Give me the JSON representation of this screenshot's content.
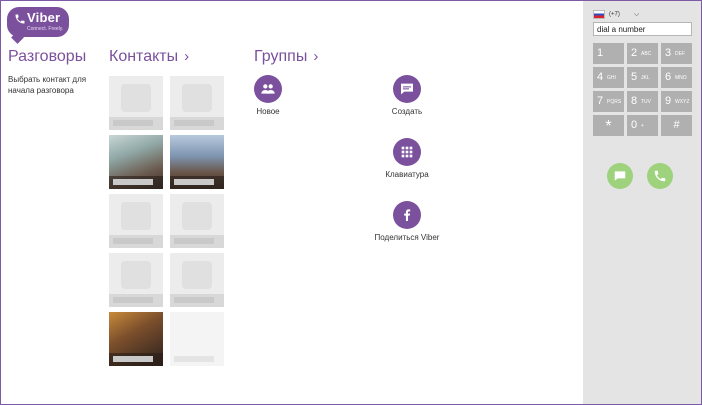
{
  "logo": {
    "word": "Viber",
    "tagline": "Connect. Freely."
  },
  "sections": {
    "conversations": {
      "title": "Разговоры"
    },
    "contacts": {
      "title": "Контакты",
      "chevron": "›"
    },
    "groups": {
      "title": "Группы",
      "chevron": "›"
    }
  },
  "conversations_hint": "Выбрать контакт для начала разговора",
  "contacts_grid": [
    {
      "kind": "placeholder"
    },
    {
      "kind": "placeholder"
    },
    {
      "kind": "photo1"
    },
    {
      "kind": "photo2"
    },
    {
      "kind": "placeholder"
    },
    {
      "kind": "placeholder"
    },
    {
      "kind": "placeholder"
    },
    {
      "kind": "placeholder"
    },
    {
      "kind": "photo3"
    },
    {
      "kind": "empty"
    }
  ],
  "actions": {
    "new_group": {
      "label": "Новое",
      "icon": "group-icon"
    },
    "create": {
      "label": "Создать",
      "icon": "chat-bubble-icon"
    },
    "keypad": {
      "label": "Клавиатура",
      "icon": "keypad-icon"
    },
    "share": {
      "label": "Поделиться Viber",
      "icon": "facebook-icon"
    }
  },
  "dialer": {
    "country_code": "(+7)",
    "country_flag": "russia-flag-icon",
    "input_placeholder": "dial a number",
    "keys": [
      {
        "digit": "1",
        "letters": ""
      },
      {
        "digit": "2",
        "letters": "ABC"
      },
      {
        "digit": "3",
        "letters": "DEF"
      },
      {
        "digit": "4",
        "letters": "GHI"
      },
      {
        "digit": "5",
        "letters": "JKL"
      },
      {
        "digit": "6",
        "letters": "MNO"
      },
      {
        "digit": "7",
        "letters": "PQRS"
      },
      {
        "digit": "8",
        "letters": "TUV"
      },
      {
        "digit": "9",
        "letters": "WXYZ"
      },
      {
        "digit": "*",
        "letters": ""
      },
      {
        "digit": "0",
        "letters": "+"
      },
      {
        "digit": "#",
        "letters": ""
      }
    ]
  },
  "colors": {
    "brand": "#7b519d",
    "dialer_bg": "#e4e4e4",
    "key": "#b0b0b0",
    "call_green": "#9ed27d"
  }
}
